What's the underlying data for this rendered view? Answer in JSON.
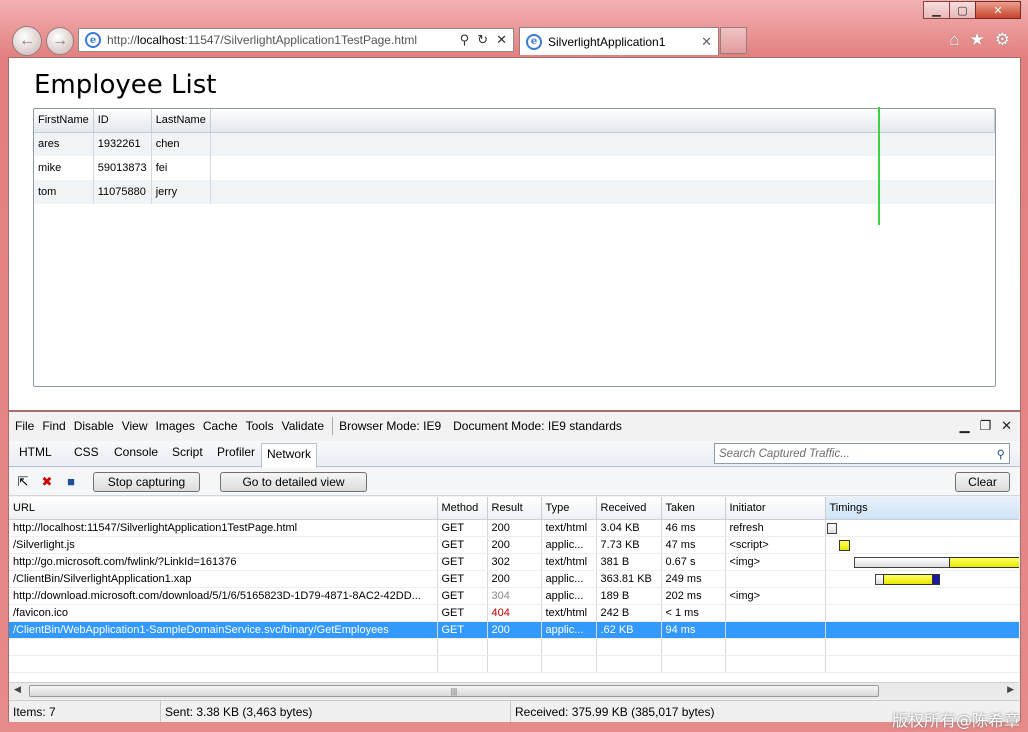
{
  "browser": {
    "url_prefix": "http://",
    "url_host": "localhost",
    "url_rest": ":11547/SilverlightApplication1TestPage.html",
    "tab_title": "SilverlightApplication1",
    "icons": [
      "back-arrow-icon",
      "forward-arrow-icon",
      "ie-logo-icon",
      "search-icon",
      "refresh-icon",
      "stop-icon",
      "close-icon",
      "home-icon",
      "favorites-star-icon",
      "gear-icon"
    ]
  },
  "page": {
    "title": "Employee List",
    "columns": [
      "FirstName",
      "ID",
      "LastName"
    ],
    "rows": [
      [
        "ares",
        "1932261",
        "chen"
      ],
      [
        "mike",
        "59013873",
        "fei"
      ],
      [
        "tom",
        "11075880",
        "jerry"
      ]
    ]
  },
  "devtools": {
    "menu": [
      "File",
      "Find",
      "Disable",
      "View",
      "Images",
      "Cache",
      "Tools",
      "Validate"
    ],
    "browser_mode_label": "Browser Mode:",
    "browser_mode_value": "IE9",
    "document_mode_label": "Document Mode:",
    "document_mode_value": "IE9 standards",
    "tabs": [
      "HTML",
      "CSS",
      "Console",
      "Script",
      "Profiler",
      "Network"
    ],
    "active_tab": "Network",
    "search_placeholder": "Search Captured Traffic...",
    "stop_button": "Stop capturing",
    "detail_button": "Go to detailed view",
    "clear_button": "Clear",
    "columns": [
      "URL",
      "Method",
      "Result",
      "Type",
      "Received",
      "Taken",
      "Initiator",
      "Timings"
    ],
    "requests": [
      {
        "url": "http://localhost:11547/SilverlightApplication1TestPage.html",
        "method": "GET",
        "result": "200",
        "type": "text/html",
        "received": "3.04 KB",
        "taken": "46 ms",
        "initiator": "refresh"
      },
      {
        "url": "/Silverlight.js",
        "method": "GET",
        "result": "200",
        "type": "applic...",
        "received": "7.73 KB",
        "taken": "47 ms",
        "initiator": "<script>"
      },
      {
        "url": "http://go.microsoft.com/fwlink/?LinkId=161376",
        "method": "GET",
        "result": "302",
        "type": "text/html",
        "received": "381 B",
        "taken": "0.67 s",
        "initiator": "<img>"
      },
      {
        "url": "/ClientBin/SilverlightApplication1.xap",
        "method": "GET",
        "result": "200",
        "type": "applic...",
        "received": "363.81 KB",
        "taken": "249 ms",
        "initiator": ""
      },
      {
        "url": "http://download.microsoft.com/download/5/1/6/5165823D-1D79-4871-8AC2-42DD...",
        "method": "GET",
        "result": "304",
        "type": "applic...",
        "received": "189 B",
        "taken": "202 ms",
        "initiator": "<img>"
      },
      {
        "url": "/favicon.ico",
        "method": "GET",
        "result": "404",
        "type": "text/html",
        "received": "242 B",
        "taken": "< 1 ms",
        "initiator": ""
      },
      {
        "url": "/ClientBin/WebApplication1-SampleDomainService.svc/binary/GetEmployees",
        "method": "GET",
        "result": "200",
        "type": "applic...",
        "received": ".62 KB",
        "taken": "94 ms",
        "initiator": ""
      }
    ],
    "selected_index": 6,
    "status_items": "Items: 7",
    "status_sent": "Sent: 3.38 KB (3,463 bytes)",
    "status_received": "Received: 375.99 KB (385,017 bytes)"
  },
  "watermark": "版权所有@陈希章"
}
